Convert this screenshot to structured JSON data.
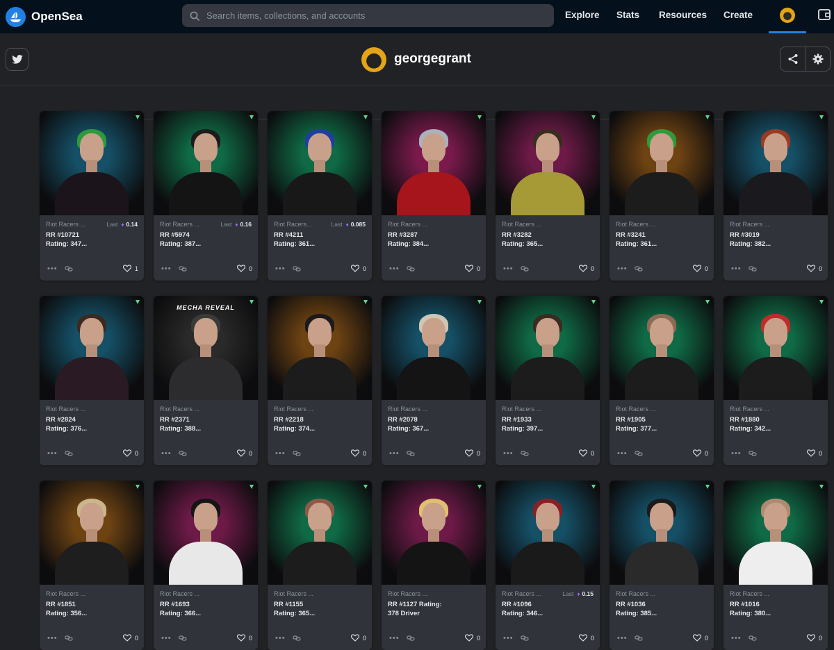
{
  "nav": {
    "brand": "OpenSea",
    "search_placeholder": "Search items, collections, and accounts",
    "links": [
      "Explore",
      "Stats",
      "Resources",
      "Create"
    ]
  },
  "profile": {
    "username": "georgegrant"
  },
  "colors": {
    "accent": "#2081e2",
    "eth": "#9d6bff",
    "nav_bg": "#04111d",
    "page_bg": "#202225",
    "card_bg": "#303339"
  },
  "cards": [
    {
      "collection": "Riot Racers ...",
      "title": "RR #10721\nRating: 347...",
      "last_label": "Last",
      "last_price": "0.14",
      "likes": "1",
      "glow": "#155066",
      "hair": "#2f9a3c",
      "outfit": "#1b141b"
    },
    {
      "collection": "Riot Racers ...",
      "title": "RR #5974\nRating: 387...",
      "last_label": "Last",
      "last_price": "0.16",
      "likes": "0",
      "glow": "#0f6a45",
      "hair": "#1d1b1b",
      "outfit": "#141414"
    },
    {
      "collection": "Riot Racers...",
      "title": "RR #4211\nRating: 361...",
      "last_label": "Last",
      "last_price": "0.085",
      "likes": "0",
      "glow": "#0f6a45",
      "hair": "#1f3ea0",
      "outfit": "#181818"
    },
    {
      "collection": "Riot Racers ...",
      "title": "RR #3287\nRating: 384...",
      "last_label": "",
      "last_price": "",
      "likes": "0",
      "glow": "#7a1a4c",
      "hair": "#aab2bd",
      "outfit": "#a5151b"
    },
    {
      "collection": "Riot Racers ...",
      "title": "RR #3282\nRating: 365...",
      "last_label": "",
      "last_price": "",
      "likes": "0",
      "glow": "#6e1a48",
      "hair": "#3a2c20",
      "outfit": "#a59a36"
    },
    {
      "collection": "Riot Racers ...",
      "title": "RR #3241\nRating: 361...",
      "last_label": "",
      "last_price": "",
      "likes": "0",
      "glow": "#6e4312",
      "hair": "#2f9a3c",
      "outfit": "#1c1c1c"
    },
    {
      "collection": "Riot Racers ...",
      "title": "RR #3019\nRating: 382...",
      "last_label": "",
      "last_price": "",
      "likes": "0",
      "glow": "#155066",
      "hair": "#9a3a22",
      "outfit": "#1a1a1e"
    },
    {
      "collection": "Riot Racers ...",
      "title": "RR #2824\nRating: 376...",
      "last_label": "",
      "last_price": "",
      "likes": "0",
      "glow": "#155066",
      "hair": "#3a2a20",
      "outfit": "#2a1a24"
    },
    {
      "collection": "Riot Racers ...",
      "title": "RR #2371\nRating: 388...",
      "last_label": "",
      "last_price": "",
      "likes": "0",
      "glow": "#2a2a2a",
      "hair": "#3a3a3a",
      "outfit": "#2c2c2e",
      "banner": "MECHA REVEAL"
    },
    {
      "collection": "Riot Racers ...",
      "title": "RR #2218\nRating: 374...",
      "last_label": "",
      "last_price": "",
      "likes": "0",
      "glow": "#6e4312",
      "hair": "#1c1a1a",
      "outfit": "#1c1c1c"
    },
    {
      "collection": "Riot Racers ...",
      "title": "RR #2078\nRating: 367...",
      "last_label": "",
      "last_price": "",
      "likes": "0",
      "glow": "#155066",
      "hair": "#cfc6b5",
      "outfit": "#141414"
    },
    {
      "collection": "Riot Racers ...",
      "title": "RR #1933\nRating: 397...",
      "last_label": "",
      "last_price": "",
      "likes": "0",
      "glow": "#0f6a45",
      "hair": "#3a2c20",
      "outfit": "#1c1c1c"
    },
    {
      "collection": "Riot Racers ...",
      "title": "RR #1905\nRating: 377...",
      "last_label": "",
      "last_price": "",
      "likes": "0",
      "glow": "#0f6a45",
      "hair": "#8d6a55",
      "outfit": "#1c1c1c"
    },
    {
      "collection": "Riot Racers ...",
      "title": "RR #1880\nRating: 342...",
      "last_label": "",
      "last_price": "",
      "likes": "0",
      "glow": "#0f6a45",
      "hair": "#c22b2b",
      "outfit": "#1c1c1c"
    },
    {
      "collection": "Riot Racers ...",
      "title": "RR #1851\nRating: 356...",
      "last_label": "",
      "last_price": "",
      "likes": "0",
      "glow": "#6e4312",
      "hair": "#cbb68c",
      "outfit": "#1e1e1e"
    },
    {
      "collection": "Riot Racers ...",
      "title": "RR #1693\nRating: 366...",
      "last_label": "",
      "last_price": "",
      "likes": "0",
      "glow": "#6e1a48",
      "hair": "#151515",
      "outfit": "#e8e8e8"
    },
    {
      "collection": "Riot Racers ...",
      "title": "RR #1155\nRating: 365...",
      "last_label": "",
      "last_price": "",
      "likes": "0",
      "glow": "#0f6a45",
      "hair": "#8d5a4a",
      "outfit": "#1c1c1c"
    },
    {
      "collection": "Riot Racers ...",
      "title": "RR #1127 Rating:\n378 Driver",
      "last_label": "",
      "last_price": "",
      "likes": "0",
      "glow": "#6e1a48",
      "hair": "#e0c070",
      "outfit": "#141414"
    },
    {
      "collection": "Riot Racers ...",
      "title": "RR #1096\nRating: 346...",
      "last_label": "Last",
      "last_price": "0.15",
      "likes": "0",
      "glow": "#155066",
      "hair": "#8a1f26",
      "outfit": "#1a1a1a"
    },
    {
      "collection": "Riot Racers ...",
      "title": "RR #1036\nRating: 385...",
      "last_label": "",
      "last_price": "",
      "likes": "0",
      "glow": "#155066",
      "hair": "#1a1a1a",
      "outfit": "#2a2a2a"
    },
    {
      "collection": "Riot Racers ...",
      "title": "RR #1016\nRating: 380...",
      "last_label": "",
      "last_price": "",
      "likes": "0",
      "glow": "#0f6a45",
      "hair": "#b08a70",
      "outfit": "#eeeeee"
    }
  ]
}
